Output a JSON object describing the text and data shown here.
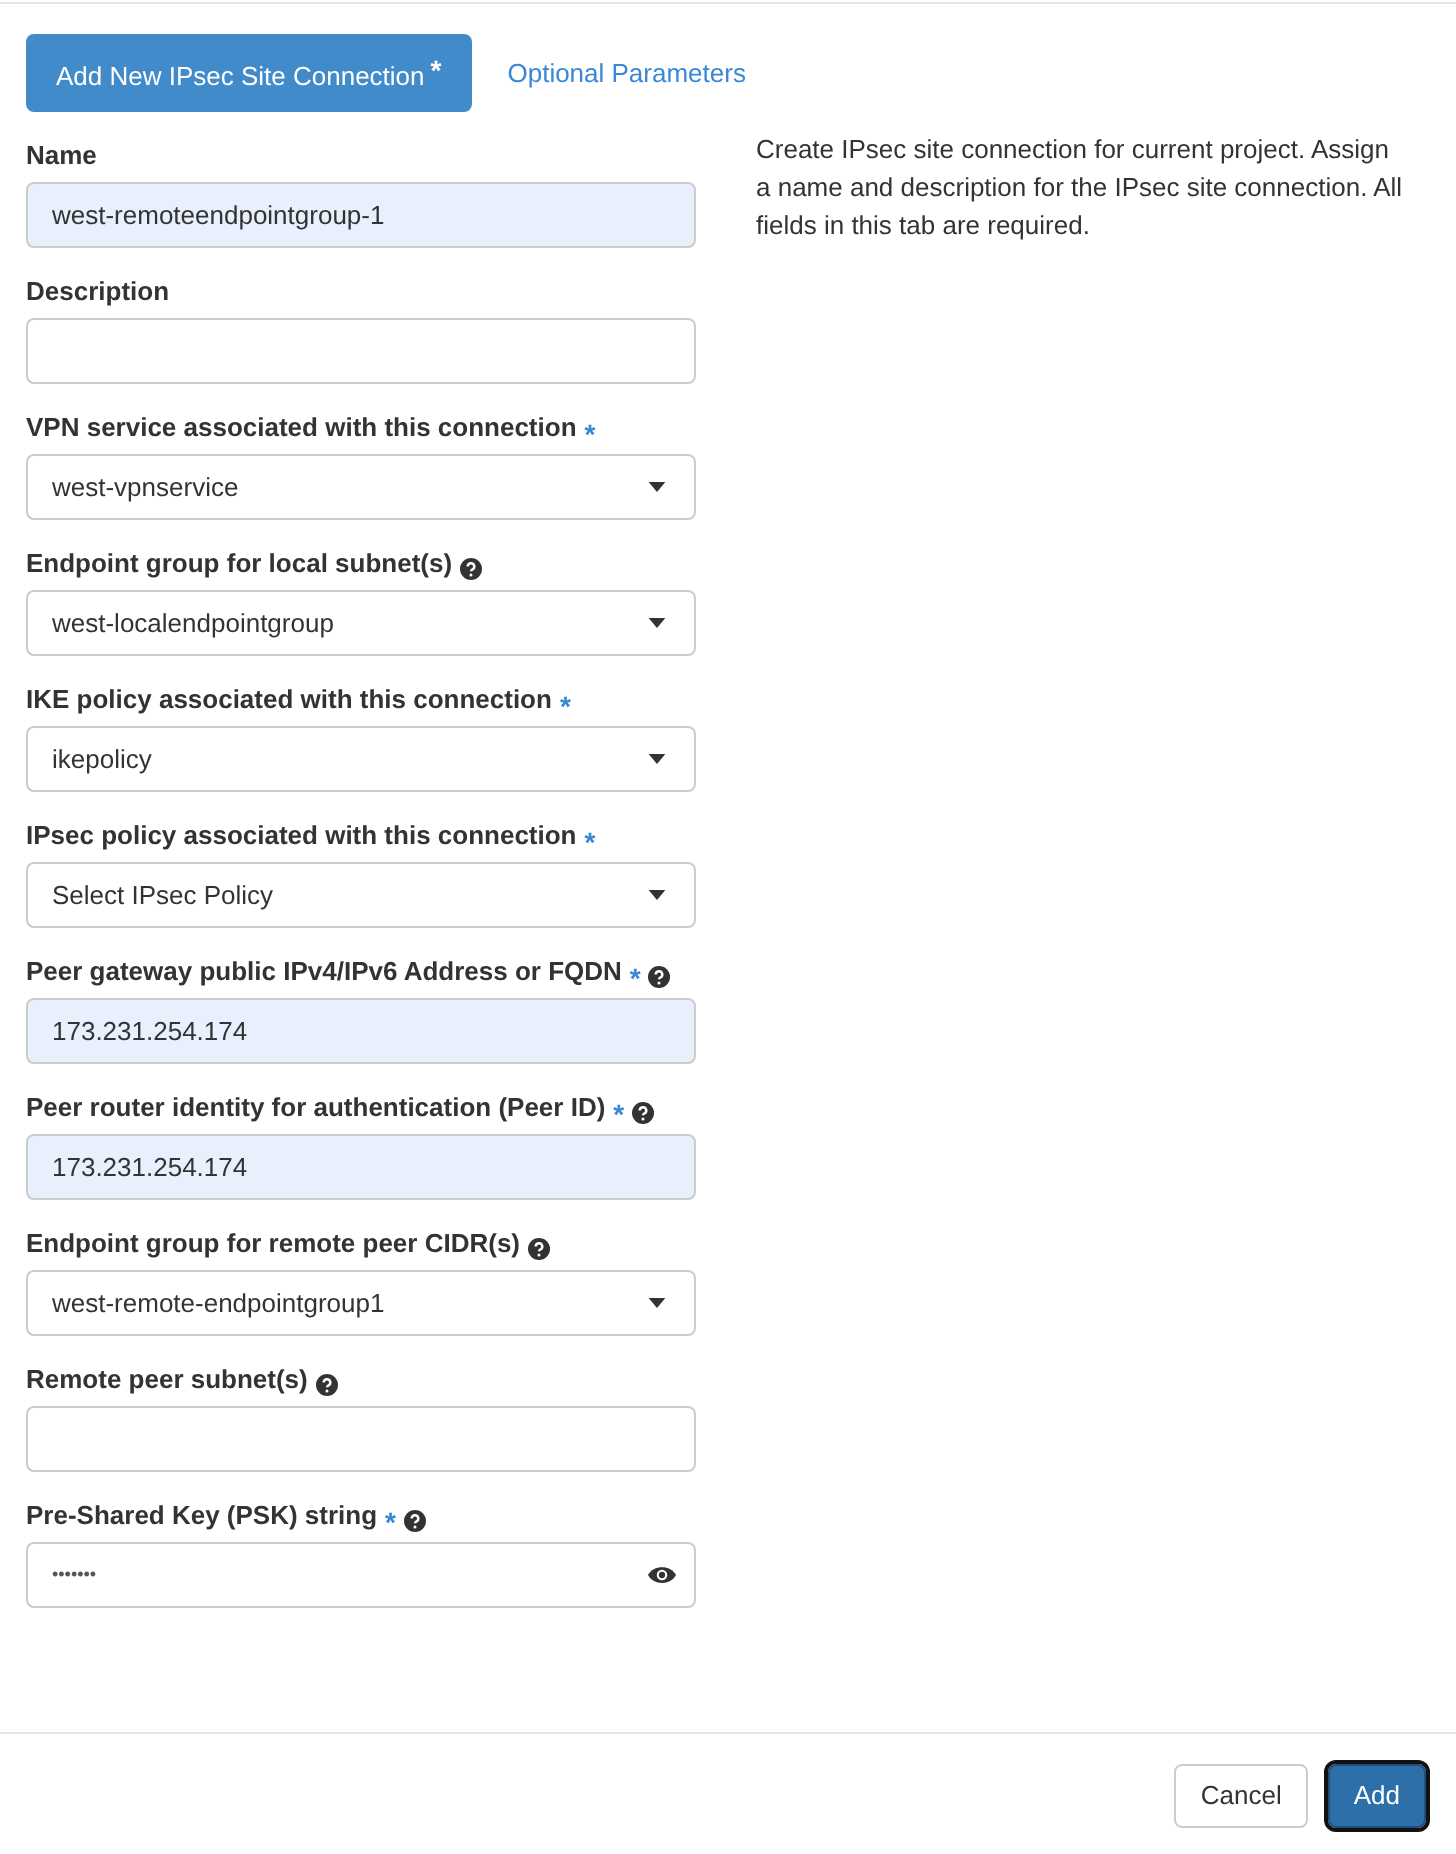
{
  "tabs": [
    {
      "label": "Add New IPsec Site Connection",
      "required_mark": "*",
      "selected": true
    },
    {
      "label": "Optional Parameters",
      "selected": false
    }
  ],
  "fields": [
    {
      "kind": "text",
      "label": "Name",
      "help": false,
      "autofilled": true,
      "value": "west-remoteendpointgroup-1"
    },
    {
      "kind": "text",
      "label": "Description",
      "help": false,
      "autofilled": false
    },
    {
      "kind": "select",
      "label": "VPN service associated with this connection",
      "required_mark": "*",
      "help": false,
      "autofilled": false,
      "value": "west-vpnservice"
    },
    {
      "kind": "select",
      "label": "Endpoint group for local subnet(s)",
      "help": true,
      "autofilled": false,
      "value": "west-localendpointgroup"
    },
    {
      "kind": "select",
      "label": "IKE policy associated with this connection",
      "required_mark": "*",
      "help": false,
      "autofilled": false,
      "value": "ikepolicy"
    },
    {
      "kind": "select",
      "label": "IPsec policy associated with this connection",
      "required_mark": "*",
      "help": false,
      "autofilled": false,
      "value": "Select IPsec Policy"
    },
    {
      "kind": "text",
      "label": "Peer gateway public IPv4/IPv6 Address or FQDN",
      "required_mark": "*",
      "help": true,
      "autofilled": true,
      "value": "173.231.254.174"
    },
    {
      "kind": "text",
      "label": "Peer router identity for authentication (Peer ID)",
      "required_mark": "*",
      "help": true,
      "autofilled": true,
      "value": "173.231.254.174"
    },
    {
      "kind": "select",
      "label": "Endpoint group for remote peer CIDR(s)",
      "help": true,
      "autofilled": false,
      "value": "west-remote-endpointgroup1"
    },
    {
      "kind": "text",
      "label": "Remote peer subnet(s)",
      "help": true,
      "autofilled": false
    },
    {
      "kind": "password",
      "label": "Pre-Shared Key (PSK) string",
      "required_mark": "*",
      "help": true,
      "autofilled": false,
      "value": "•••••••"
    }
  ],
  "description": "Create IPsec site connection for current project. Assign a name and description for the IPsec site connection. All fields in this tab are required.",
  "buttons": [
    {
      "label": "Cancel",
      "kind": "default"
    },
    {
      "label": "Add",
      "kind": "primary"
    }
  ]
}
